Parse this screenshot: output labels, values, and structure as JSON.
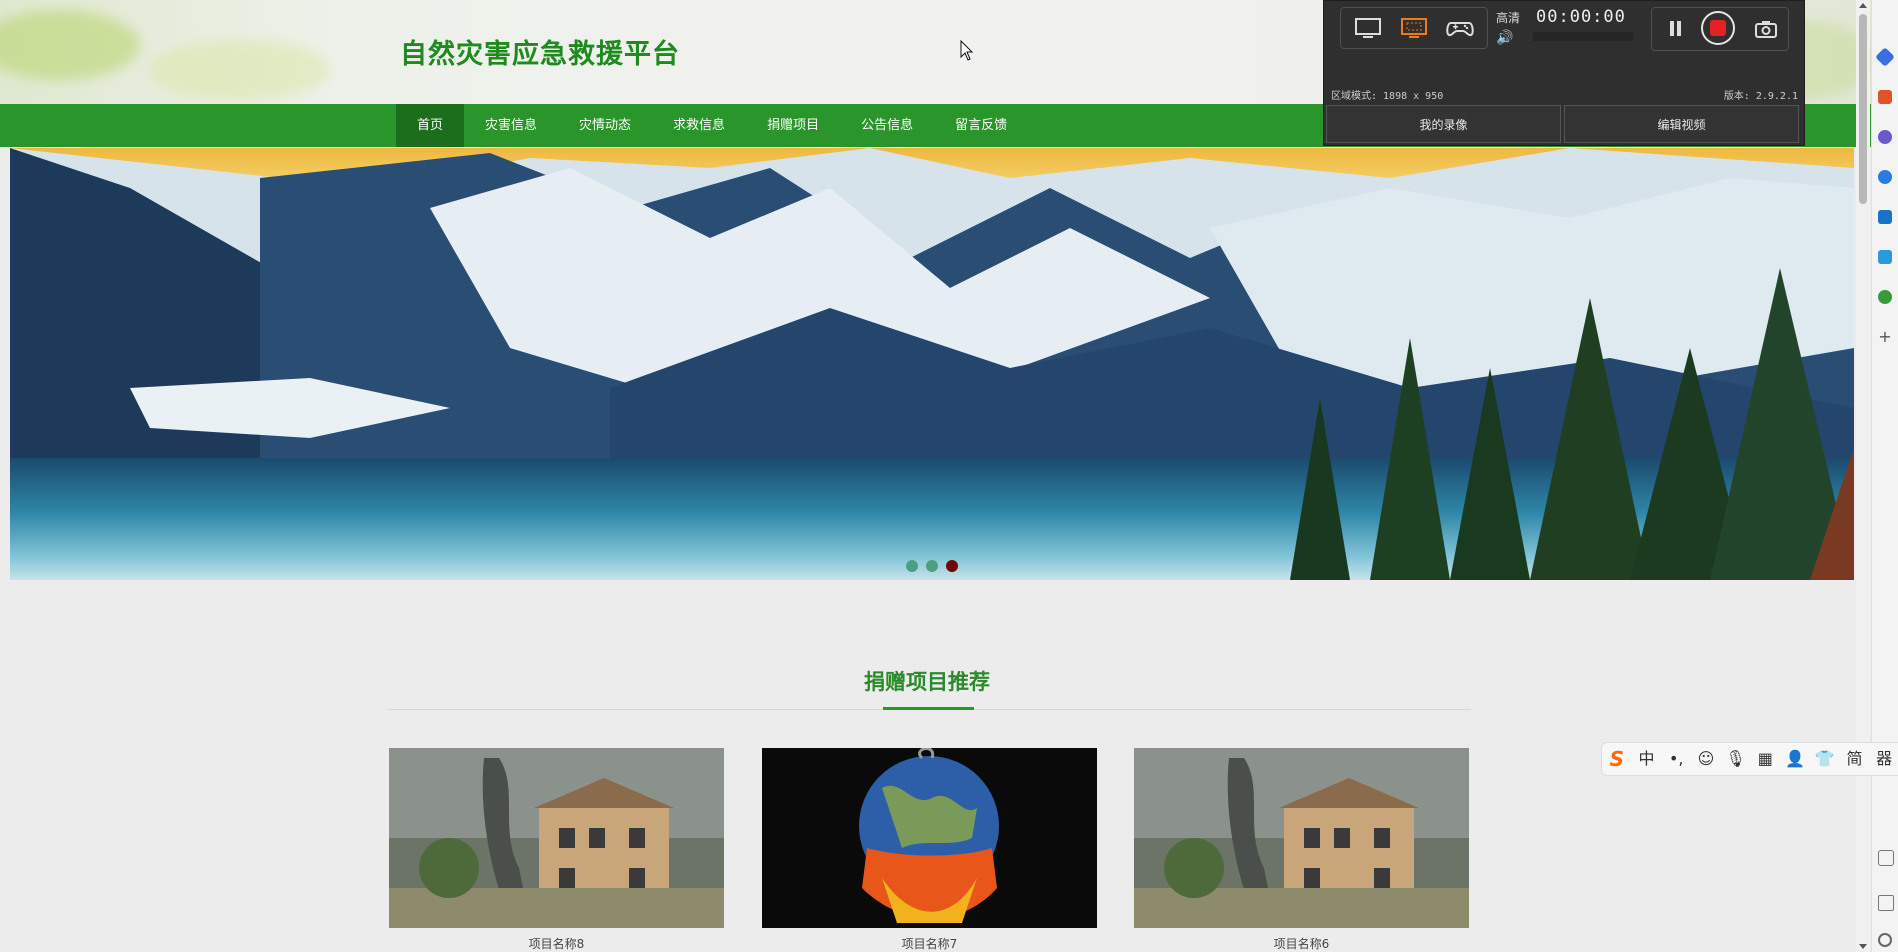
{
  "site": {
    "title": "自然灾害应急救援平台"
  },
  "nav": {
    "items": [
      {
        "label": "首页",
        "active": true
      },
      {
        "label": "灾害信息"
      },
      {
        "label": "灾情动态"
      },
      {
        "label": "求救信息"
      },
      {
        "label": "捐赠项目"
      },
      {
        "label": "公告信息"
      },
      {
        "label": "留言反馈"
      }
    ]
  },
  "banner": {
    "slide_count": 3,
    "active_slide": 3
  },
  "section": {
    "title": "捐赠项目推荐"
  },
  "projects": [
    {
      "name": "项目名称8"
    },
    {
      "name": "项目名称7"
    },
    {
      "name": "项目名称6"
    }
  ],
  "recorder": {
    "quality": "高清",
    "timer": "00:00:00",
    "area_mode": "区域模式: 1898 x 950",
    "version": "版本: 2.9.2.1",
    "my_recordings": "我的录像",
    "edit_video": "编辑视频"
  },
  "ime": {
    "items": [
      "S",
      "中",
      "•,",
      "☺",
      "🎙",
      "▦",
      "👤",
      "👕",
      "简",
      "器"
    ]
  },
  "colors": {
    "brand_green": "#2a952a",
    "title_green": "#1f8a1f",
    "nav_active": "#1c6e1c",
    "dot_active": "#6b0a0a",
    "dot": "#4d9e83"
  }
}
